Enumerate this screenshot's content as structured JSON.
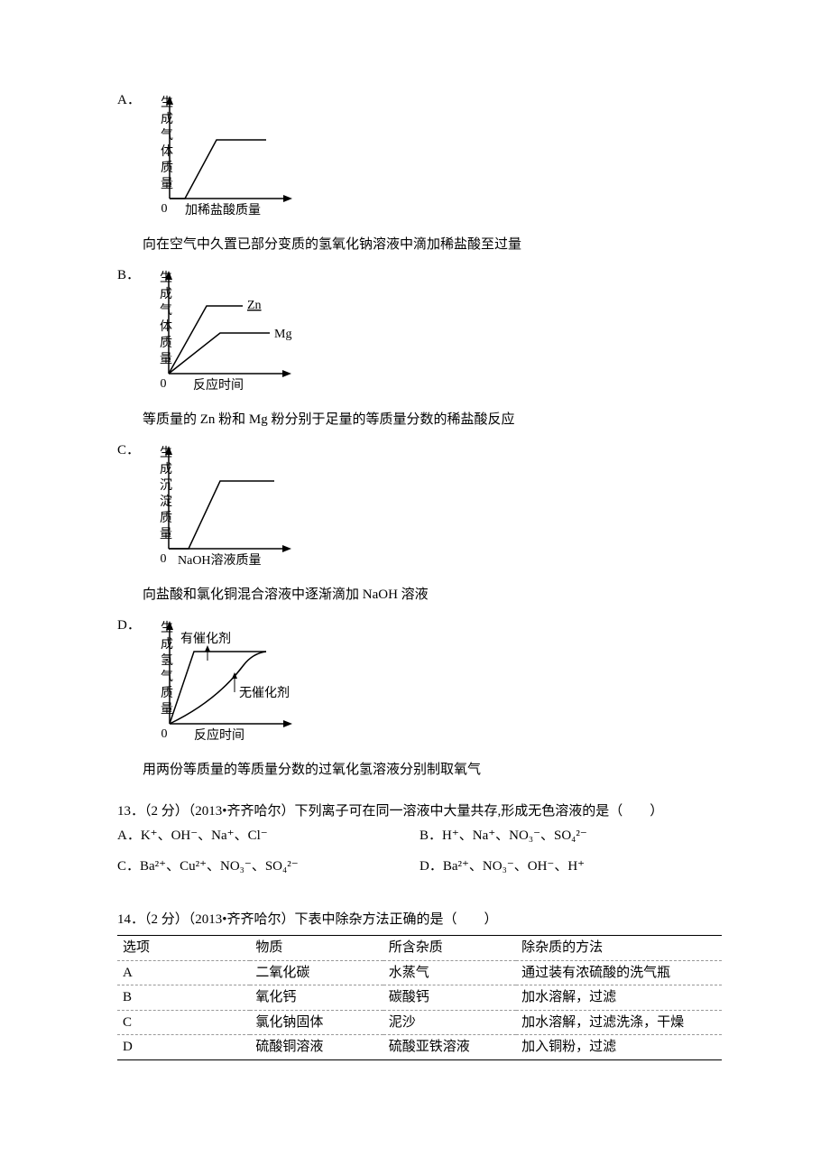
{
  "q12": {
    "options": {
      "A": {
        "label": "A．",
        "yAxis": "生成气体质量",
        "xAxis": "加稀盐酸质量",
        "origin": "0",
        "caption": "向在空气中久置已部分变质的氢氧化钠溶液中滴加稀盐酸至过量"
      },
      "B": {
        "label": "B．",
        "yAxis": "生成气体质量",
        "xAxis": "反应时间",
        "origin": "0",
        "series1": "Zn",
        "series2": "Mg",
        "caption": "等质量的 Zn 粉和 Mg 粉分别于足量的等质量分数的稀盐酸反应"
      },
      "C": {
        "label": "C．",
        "yAxis": "生成沉淀质量",
        "xAxis": "NaOH溶液质量",
        "origin": "0",
        "caption": "向盐酸和氯化铜混合溶液中逐渐滴加 NaOH 溶液"
      },
      "D": {
        "label": "D．",
        "yAxis": "生成氢气质量",
        "xAxis": "反应时间",
        "origin": "0",
        "series1": "有催化剂",
        "series2": "无催化剂",
        "caption": "用两份等质量的等质量分数的过氧化氢溶液分别制取氧气"
      }
    }
  },
  "q13": {
    "stem": "13．（2 分）（2013•齐齐哈尔）下列离子可在同一溶液中大量共存,形成无色溶液的是（　　）",
    "A": {
      "label": "A．",
      "ions": "K⁺、OH⁻、Na⁺、Cl⁻"
    },
    "B": {
      "label": "B．",
      "ions": "H⁺、Na⁺、NO₃⁻、SO₄²⁻"
    },
    "C": {
      "label": "C．",
      "ions": "Ba²⁺、Cu²⁺、NO₃⁻、SO₄²⁻"
    },
    "D": {
      "label": "D．",
      "ions": "Ba²⁺、NO₃⁻、OH⁻、H⁺"
    }
  },
  "q14": {
    "stem": "14．（2 分）（2013•齐齐哈尔）下表中除杂方法正确的是（　　）",
    "headers": {
      "c1": "选项",
      "c2": "物质",
      "c3": "所含杂质",
      "c4": "除杂质的方法"
    },
    "rows": {
      "A": {
        "c1": "A",
        "c2": "二氧化碳",
        "c3": "水蒸气",
        "c4": "通过装有浓硫酸的洗气瓶"
      },
      "B": {
        "c1": "B",
        "c2": "氧化钙",
        "c3": "碳酸钙",
        "c4": "加水溶解，过滤"
      },
      "C": {
        "c1": "C",
        "c2": "氯化钠固体",
        "c3": "泥沙",
        "c4": "加水溶解，过滤洗涤，干燥"
      },
      "D": {
        "c1": "D",
        "c2": "硫酸铜溶液",
        "c3": "硫酸亚铁溶液",
        "c4": "加入铜粉，过滤"
      }
    }
  },
  "chart_data": [
    {
      "type": "line",
      "option": "A",
      "ylabel": "生成气体质量",
      "xlabel": "加稀盐酸质量",
      "description": "曲线从原点之后某x值开始上升,到一定值后变为水平",
      "series": [
        {
          "name": "",
          "shape": "delayed-rise-then-plateau"
        }
      ]
    },
    {
      "type": "line",
      "option": "B",
      "ylabel": "生成气体质量",
      "xlabel": "反应时间",
      "description": "两条从原点上升然后变平的曲线, Zn 的最终平台高于 Mg",
      "series": [
        {
          "name": "Zn",
          "final": "higher"
        },
        {
          "name": "Mg",
          "final": "lower"
        }
      ]
    },
    {
      "type": "line",
      "option": "C",
      "ylabel": "生成沉淀质量",
      "xlabel": "NaOH溶液质量",
      "description": "曲线先在x轴上一段为0,然后上升到平台",
      "series": [
        {
          "name": "",
          "shape": "delayed-rise-then-plateau"
        }
      ]
    },
    {
      "type": "line",
      "option": "D",
      "ylabel": "生成氢气质量",
      "xlabel": "反应时间",
      "description": "两条曲线上升到同一平台,有催化剂的更快到达",
      "series": [
        {
          "name": "有催化剂",
          "rate": "fast",
          "final": "same"
        },
        {
          "name": "无催化剂",
          "rate": "slow",
          "final": "same"
        }
      ]
    }
  ]
}
